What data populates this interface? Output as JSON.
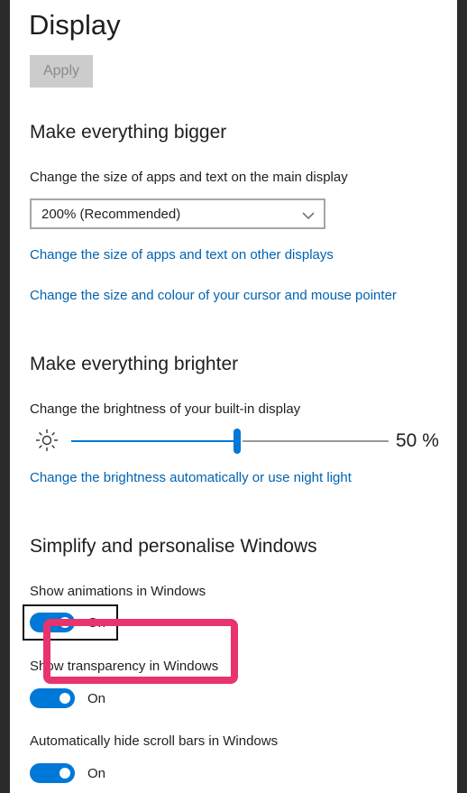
{
  "page": {
    "title": "Display",
    "apply_label": "Apply"
  },
  "bigger": {
    "heading": "Make everything bigger",
    "size_label": "Change the size of apps and text on the main display",
    "size_value": "200% (Recommended)",
    "link_other_displays": "Change the size of apps and text on other displays",
    "link_cursor": "Change the size and colour of your cursor and mouse pointer"
  },
  "brighter": {
    "heading": "Make everything brighter",
    "brightness_label": "Change the brightness of your built-in display",
    "brightness_value": "50 %",
    "brightness_level": 0.5,
    "link_night_light": "Change the brightness automatically or use night light"
  },
  "simplify": {
    "heading": "Simplify and personalise Windows",
    "animations_label": "Show animations in Windows",
    "animations_state": "On",
    "transparency_label": "Show transparency in Windows",
    "transparency_state": "On",
    "scrollbars_label": "Automatically hide scroll bars in Windows",
    "scrollbars_state": "On"
  },
  "icons": {
    "brightness": "sun-icon",
    "dropdown": "chevron-down-icon"
  },
  "colors": {
    "accent": "#0078d7",
    "link": "#0063b1",
    "highlight": "#e8336c"
  }
}
